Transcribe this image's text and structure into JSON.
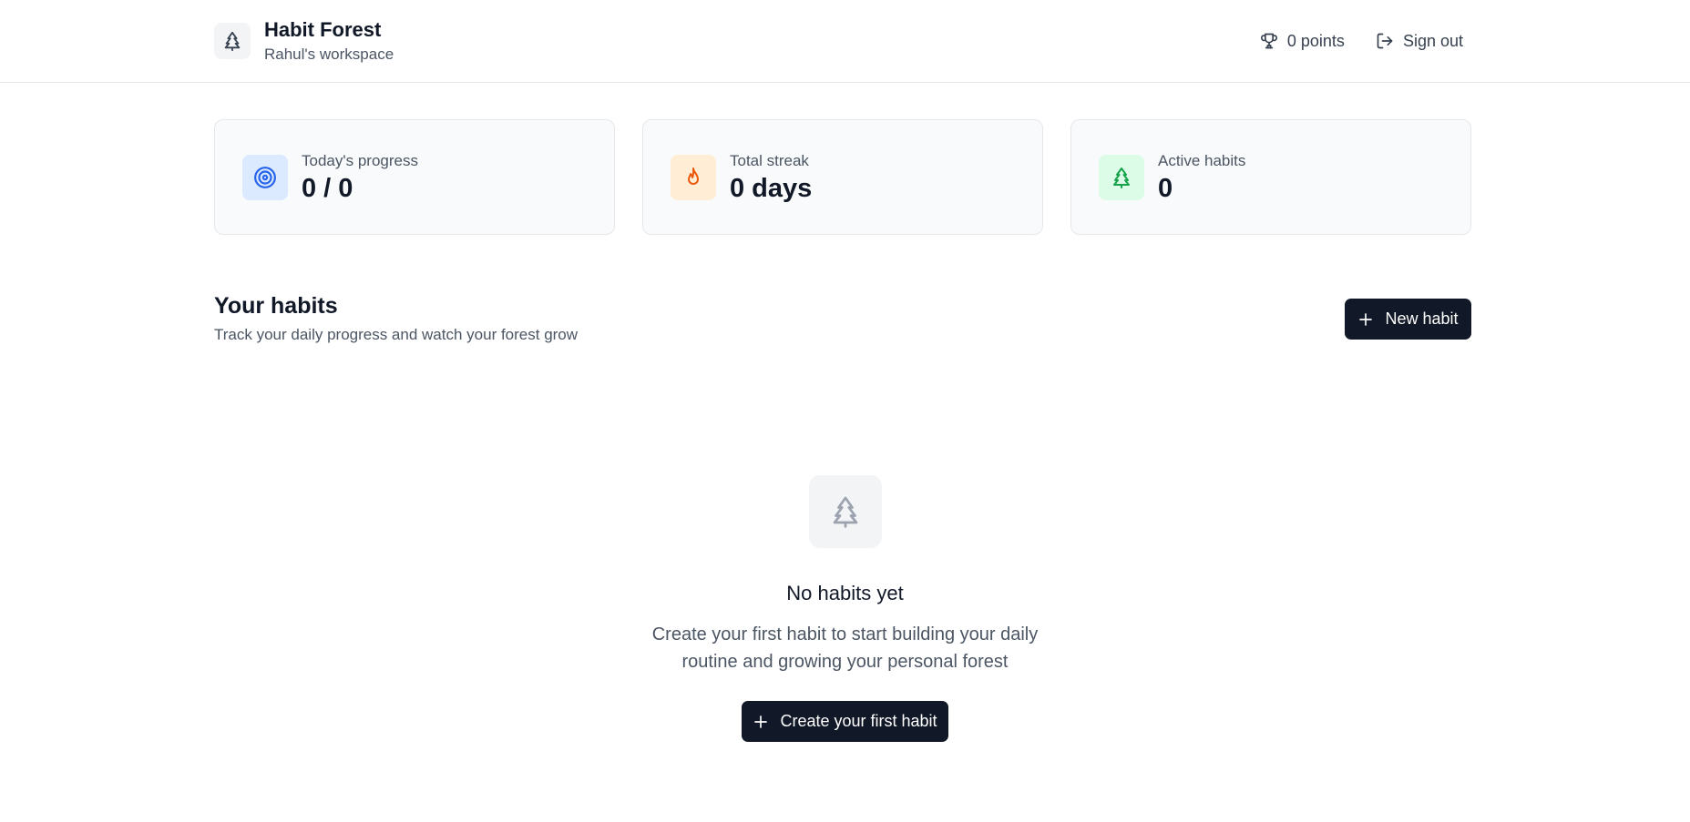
{
  "header": {
    "app_name": "Habit Forest",
    "workspace": "Rahul's workspace",
    "points_label": "0 points",
    "signout_label": "Sign out"
  },
  "stats": [
    {
      "label": "Today's progress",
      "value": "0 / 0",
      "icon": "target-icon",
      "icon_bg": "#dbeafe",
      "icon_color": "#2563eb"
    },
    {
      "label": "Total streak",
      "value": "0 days",
      "icon": "flame-icon",
      "icon_bg": "#ffedd5",
      "icon_color": "#ea580c"
    },
    {
      "label": "Active habits",
      "value": "0",
      "icon": "tree-icon",
      "icon_bg": "#dcfce7",
      "icon_color": "#16a34a"
    }
  ],
  "habits": {
    "title": "Your habits",
    "subtitle": "Track your daily progress and watch your forest grow",
    "new_button_label": "New habit"
  },
  "empty_state": {
    "title": "No habits yet",
    "description": "Create your first habit to start building your daily routine and growing your personal forest",
    "button_label": "Create your first habit"
  },
  "colors": {
    "primary_dark": "#111827",
    "border": "#e5e7eb",
    "muted_text": "#4b5563"
  }
}
